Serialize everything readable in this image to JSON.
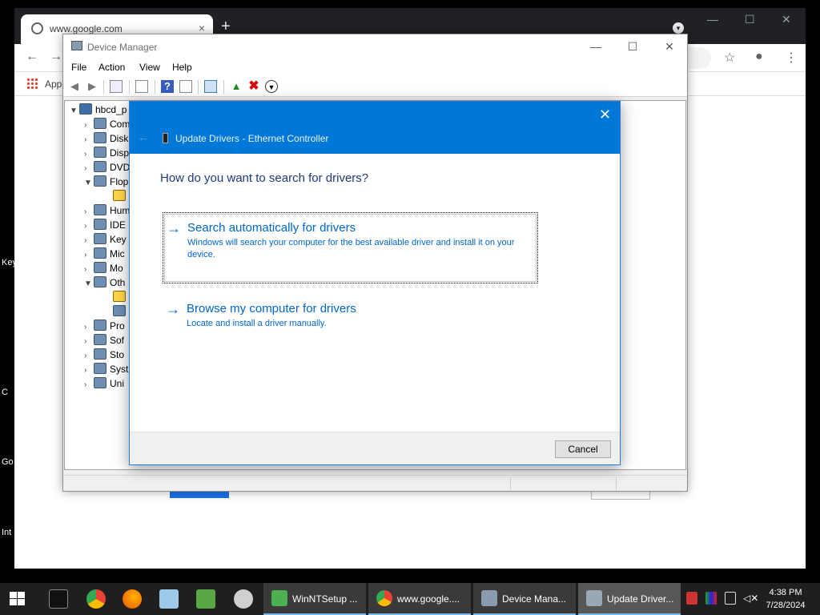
{
  "desktop": {
    "labels": [
      "Key",
      "C",
      "Go",
      "Int"
    ]
  },
  "chrome": {
    "tab_title": "www.google.com",
    "tab_close": "×",
    "new_tab": "+",
    "window_controls": [
      "—",
      "☐",
      "✕"
    ],
    "bookmarks": {
      "apps_label": "Apps"
    }
  },
  "device_manager": {
    "title": "Device Manager",
    "window_controls": [
      "—",
      "☐",
      "✕"
    ],
    "menu": [
      "File",
      "Action",
      "View",
      "Help"
    ],
    "tree": {
      "root": "hbcd_p",
      "items": [
        {
          "label": "Com",
          "expanded": false
        },
        {
          "label": "Disk",
          "expanded": false
        },
        {
          "label": "Disp",
          "expanded": false
        },
        {
          "label": "DVD",
          "expanded": false
        },
        {
          "label": "Flop",
          "expanded": true
        },
        {
          "label": "",
          "child": true,
          "warning": true
        },
        {
          "label": "Hum",
          "expanded": false
        },
        {
          "label": "IDE",
          "expanded": false
        },
        {
          "label": "Key",
          "expanded": false
        },
        {
          "label": "Mic",
          "expanded": false
        },
        {
          "label": "Mo",
          "expanded": false
        },
        {
          "label": "Oth",
          "expanded": true
        },
        {
          "label": "",
          "child": true,
          "warning": true
        },
        {
          "label": "",
          "child": true,
          "warning": false
        },
        {
          "label": "Pro",
          "expanded": false
        },
        {
          "label": "Sof",
          "expanded": false
        },
        {
          "label": "Sto",
          "expanded": false
        },
        {
          "label": "Syst",
          "expanded": false
        },
        {
          "label": "Uni",
          "expanded": false
        }
      ]
    }
  },
  "dialog": {
    "title": "Update Drivers - Ethernet Controller",
    "close": "✕",
    "back": "←",
    "question": "How do you want to search for drivers?",
    "options": [
      {
        "arrow": "→",
        "title": "Search automatically for drivers",
        "description": "Windows will search your computer for the best available driver and install it on your device."
      },
      {
        "arrow": "→",
        "title": "Browse my computer for drivers",
        "description": "Locate and install a driver manually."
      }
    ],
    "cancel_label": "Cancel"
  },
  "taskbar": {
    "tasks": [
      {
        "label": "WinNTSetup ...",
        "icon_color": "#4caf50"
      },
      {
        "label": "www.google....",
        "icon_color": "#4285f4"
      },
      {
        "label": "Device Mana...",
        "icon_color": "#8a9bb0"
      },
      {
        "label": "Update Driver...",
        "icon_color": "#9aa7b5",
        "active": true
      }
    ],
    "clock": {
      "time": "4:38 PM",
      "date": "7/28/2024"
    }
  }
}
